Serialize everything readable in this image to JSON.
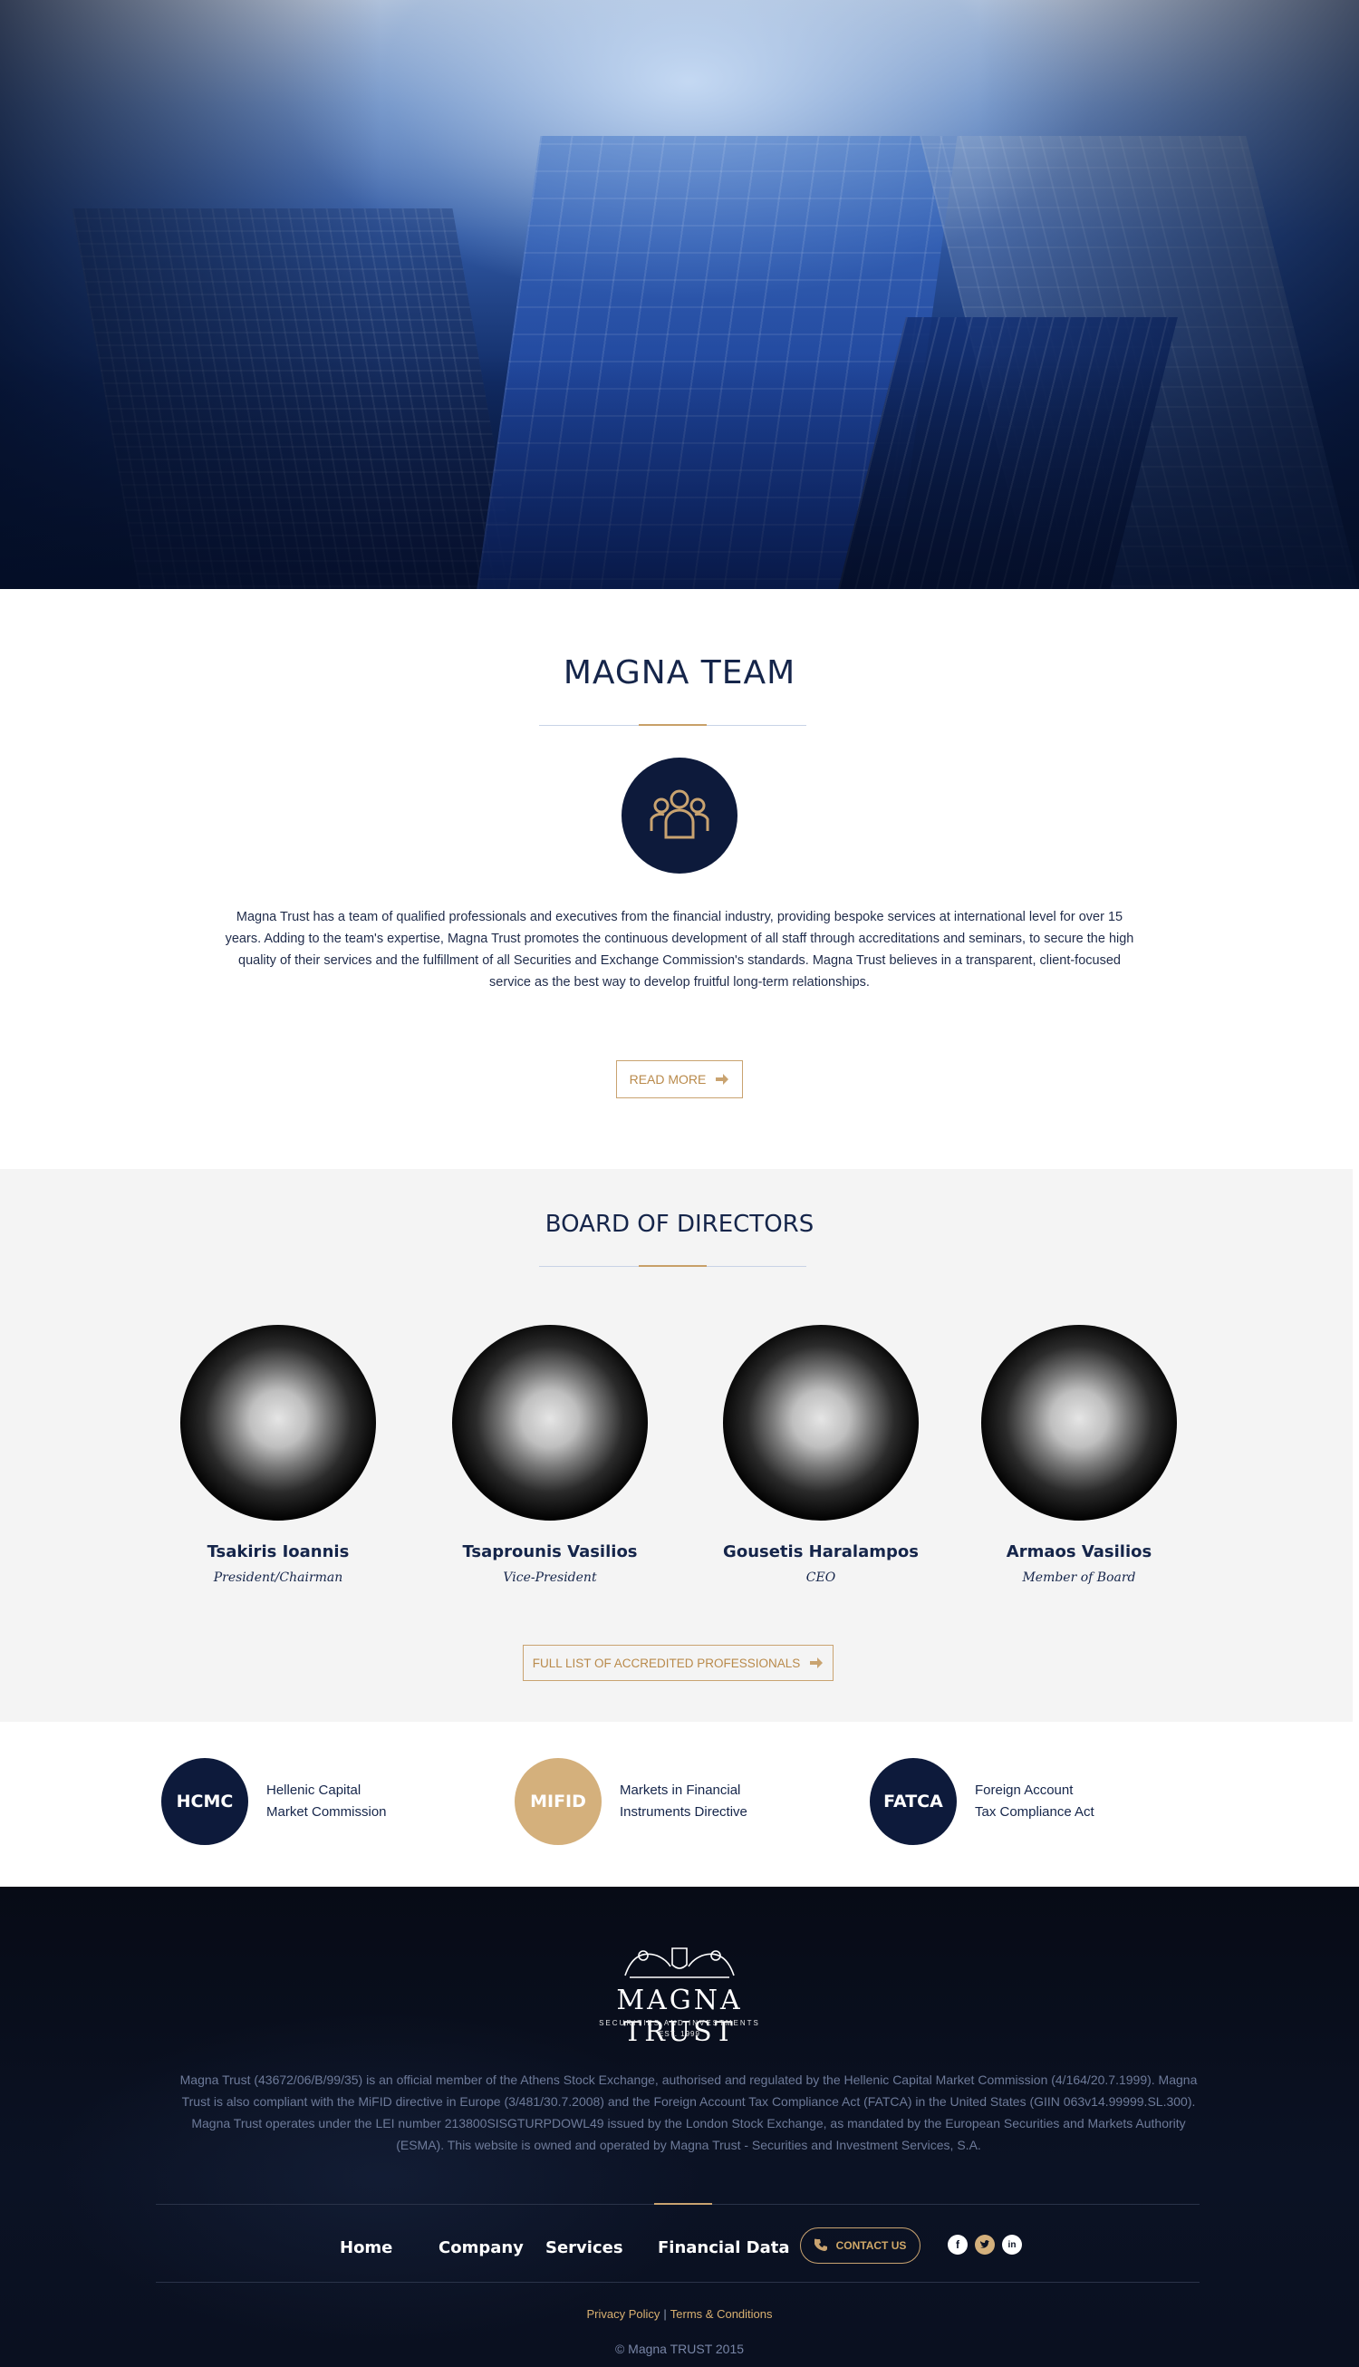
{
  "team": {
    "title": "MAGNA TEAM",
    "icon": "team-icon",
    "text": "Magna Trust has a team of qualified professionals and executives from the financial industry, providing bespoke services at international level for over 15 years. Adding to the team's expertise, Magna Trust promotes the continuous development of all staff through accreditations and seminars, to secure the high quality of their services and the fulfillment of all Securities and Exchange Commission's standards. Magna Trust believes in a transparent, client-focused service as the best way to develop fruitful long-term relationships.",
    "read_more_label": "READ MORE"
  },
  "board": {
    "title": "BOARD OF DIRECTORS",
    "directors": [
      {
        "name": "Tsakiris Ioannis",
        "role": "President/Chairman"
      },
      {
        "name": "Tsaprounis Vasilios",
        "role": "Vice-President"
      },
      {
        "name": "Gousetis Haralampos",
        "role": "CEO"
      },
      {
        "name": "Armaos Vasilios",
        "role": "Member of Board"
      }
    ],
    "full_list_label": "FULL LIST OF ACCREDITED PROFESSIONALS"
  },
  "badges": [
    {
      "code": "HCMC",
      "line1": "Hellenic Capital",
      "line2": "Market Commission",
      "color": "#0d1a3b"
    },
    {
      "code": "MIFID",
      "line1": "Markets in Financial",
      "line2": "Instruments Directive",
      "color": "#d4b07c"
    },
    {
      "code": "FATCA",
      "line1": "Foreign Account",
      "line2": "Tax Compliance Act",
      "color": "#0d1a3b"
    }
  ],
  "footer": {
    "logo_name": "MAGNA TRUST",
    "logo_tagline": "SECURITIES AND INVESTMENTS",
    "logo_est": "EST. 1999",
    "text": "Magna Trust (43672/06/B/99/35) is an official member of the Athens Stock Exchange, authorised and regulated by the Hellenic Capital Market Commission (4/164/20.7.1999). Magna Trust is also compliant with the MiFID directive in Europe (3/481/30.7.2008) and the Foreign Account Tax Compliance Act (FATCA) in the United States (GIIN 063v14.99999.SL.300). Magna Trust operates under the LEI number 213800SISGTURPDOWL49 issued by the London Stock Exchange, as mandated by the European Securities and Markets Authority (ESMA). This website is owned and operated by Magna Trust - Securities and Investment Services, S.A.",
    "nav": [
      "Home",
      "Company",
      "Services",
      "Financial Data"
    ],
    "contact_label": "CONTACT US",
    "social": [
      "facebook-icon",
      "twitter-icon",
      "linkedin-icon"
    ],
    "privacy": "Privacy Policy",
    "separator": "|",
    "terms": "Terms & Conditions",
    "copyright": "© Magna TRUST 2015"
  },
  "colors": {
    "navy": "#0d1a3b",
    "gold": "#c9a370",
    "board_bg": "#f4f4f4",
    "footer_bg": "#0b1224"
  }
}
